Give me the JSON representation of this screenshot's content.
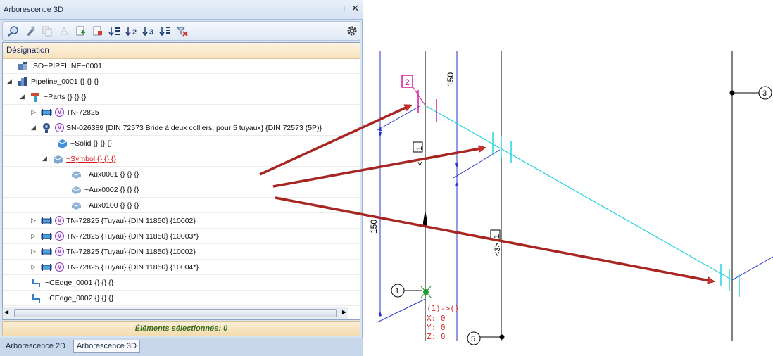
{
  "panel": {
    "title": "Arborescence 3D",
    "pin_glyph": "⊥",
    "close_glyph": "✕",
    "toolbar_icons": [
      "search-icon",
      "pick-icon",
      "copy-icon",
      "delete-icon",
      "add-icon",
      "paste-icon",
      "sort-1-icon",
      "sort-2-icon",
      "sort-3-icon",
      "sort-down-icon",
      "clear-filter-icon",
      "gear-icon"
    ],
    "column_header": "Désignation",
    "status": "Éléments sélectionnés: 0",
    "tabs": [
      "Arborescence 2D",
      "Arborescence 3D"
    ],
    "active_tab": "Arborescence 3D"
  },
  "tree": [
    {
      "label": "ISO~PIPELINE~0001",
      "icon": "assembly-icon",
      "expand": "",
      "variant": false,
      "red": false
    },
    {
      "label": "Pipeline_0001 {} {} {}",
      "icon": "pipeline-icon",
      "expand": "◢",
      "variant": false,
      "red": false
    },
    {
      "label": "~Parts {} {} {}",
      "icon": "parts-icon",
      "expand": "◢",
      "variant": false,
      "red": false
    },
    {
      "label": "TN-72825",
      "icon": "pipe-icon",
      "expand": "▷",
      "variant": true,
      "red": false
    },
    {
      "label": "SN-026389 {DIN 72573 Bride à deux colliers, pour 5 tuyaux} {DIN 72573 (5P)}",
      "icon": "clamp-icon",
      "expand": "◢",
      "variant": true,
      "red": false
    },
    {
      "label": "~Solid {} {} {}",
      "icon": "solid-icon",
      "expand": "",
      "variant": false,
      "red": false
    },
    {
      "label": "~Symbol {} {} {}",
      "icon": "symbol-icon",
      "expand": "◢",
      "variant": false,
      "red": true
    },
    {
      "label": "~Aux0001 {} {} {}",
      "icon": "aux-icon",
      "expand": "",
      "variant": false,
      "red": false
    },
    {
      "label": "~Aux0002 {} {} {}",
      "icon": "aux-icon",
      "expand": "",
      "variant": false,
      "red": false
    },
    {
      "label": "~Aux0100 {} {} {}",
      "icon": "aux-icon",
      "expand": "",
      "variant": false,
      "red": false
    },
    {
      "label": "TN-72825 {Tuyau} {DIN 11850} {10002}",
      "icon": "pipe-icon",
      "expand": "▷",
      "variant": true,
      "red": false
    },
    {
      "label": "TN-72825 {Tuyau} {DIN 11850} {10003*}",
      "icon": "pipe-icon",
      "expand": "▷",
      "variant": true,
      "red": false
    },
    {
      "label": "TN-72825 {Tuyau} {DIN 11850} {10002}",
      "icon": "pipe-icon",
      "expand": "▷",
      "variant": true,
      "red": false
    },
    {
      "label": "TN-72825 {Tuyau} {DIN 11850} {10004*}",
      "icon": "pipe-icon",
      "expand": "▷",
      "variant": true,
      "red": false
    },
    {
      "label": "~CEdge_0001 {} {} {}",
      "icon": "edge-icon",
      "expand": "",
      "variant": false,
      "red": false
    },
    {
      "label": "~CEdge_0002 {} {} {}",
      "icon": "edge-icon",
      "expand": "",
      "variant": false,
      "red": false
    }
  ],
  "variant_glyph": "V",
  "cad": {
    "dim_150_top": "150",
    "dim_150_left": "150",
    "box_2": "2",
    "box_1a": "1",
    "box_1b": "1",
    "label_lt1": "<",
    "label_lt3": "<3>",
    "bubble_1": "1",
    "bubble_3": "3",
    "bubble_5": "5",
    "coord_title": "(1)->()",
    "coord_x": "X:  0",
    "coord_y": "Y:  0",
    "coord_z": "Z:  0",
    "colors": {
      "blue": "#2a37c9",
      "cyan": "#22d3e0",
      "magenta": "#d01a9a",
      "red": "#d0302b",
      "black": "#000000"
    }
  }
}
